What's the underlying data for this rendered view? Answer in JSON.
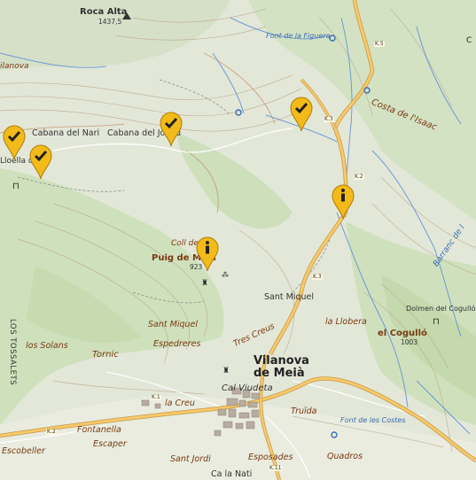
{
  "labels": {
    "roca_alta": "Roca Alta",
    "roca_alta_elev": "1437,5",
    "font_figuera": "Font de la Figuera",
    "costa_isaac": "Costa de l'Isaac",
    "vilanova_partial": "ilanova",
    "cabana_nari": "Cabana del Nari",
    "cabana_joaqu": "Cabana del Joaqu",
    "lloella": "Lloella del",
    "coll_de": "Coll de",
    "puig_meia": "Puig de Meià",
    "puig_meia_elev": "923",
    "sant_miquel_upper": "Sant Miquel",
    "barranc": "Barranc de l",
    "dolmen": "Dolmen del Cogulló",
    "la_llobera": "la Llobera",
    "el_cogullo": "el Cogulló",
    "el_cogullo_elev": "1003",
    "los_tossalets": "LOS TOSSALETS",
    "sant_miquel": "Sant Miquel",
    "espedreres": "Espedreres",
    "los_solans": "los Solans",
    "tres_creus": "Tres Creus",
    "tornic": "Tornic",
    "vilanova_l1": "Vilanova",
    "vilanova_l2": "de Meià",
    "cal_viudeta": "Cal Viudeta",
    "la_creu": "la Creu",
    "truida": "Truïda",
    "font_costes": "Font de les Costes",
    "fontanella": "Fontanella",
    "escaper": "Escaper",
    "escobeller": "Escobeller",
    "sant_jordi": "Sant Jordi",
    "esposades": "Esposades",
    "quadros": "Quadros",
    "ca_la_nati": "Ca la Nati"
  },
  "road_refs": {
    "k5": "K.5",
    "k3a": "K.3",
    "k2a": "K.2",
    "k3b": "K.3",
    "k1": "K.1",
    "k2b": "K.2",
    "k11": "K.11"
  },
  "markers": [
    {
      "name": "visited-marker-nari-1",
      "kind": "check"
    },
    {
      "name": "visited-marker-nari-2",
      "kind": "check"
    },
    {
      "name": "visited-marker-joaquim",
      "kind": "check"
    },
    {
      "name": "visited-marker-north",
      "kind": "check"
    },
    {
      "name": "info-marker-road",
      "kind": "info"
    },
    {
      "name": "info-marker-puig-meia",
      "kind": "info"
    }
  ],
  "colors": {
    "marker_fill": "#f2bb1a",
    "marker_stroke": "#b07d06",
    "road_main": "#f7c86a",
    "water": "#5b8fd6",
    "contour": "#b9a88a",
    "forest": "#c5dbb0"
  }
}
